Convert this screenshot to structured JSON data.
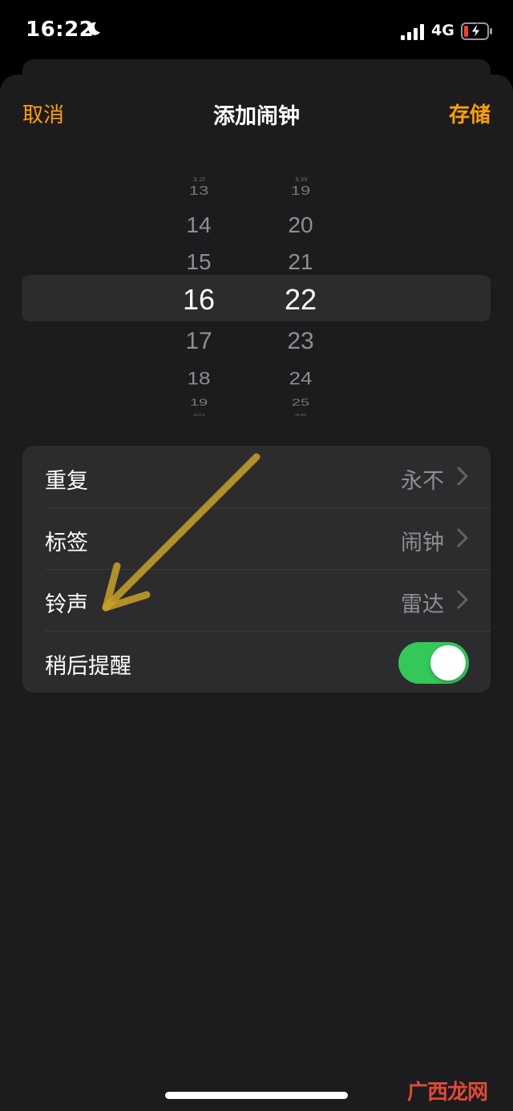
{
  "status_bar": {
    "time": "16:22",
    "network": "4G",
    "icons": [
      "moon-icon",
      "signal-icon",
      "battery-charging-icon"
    ]
  },
  "nav": {
    "cancel": "取消",
    "title": "添加闹钟",
    "save": "存储"
  },
  "picker": {
    "hours": [
      "12",
      "13",
      "14",
      "15",
      "16",
      "17",
      "18",
      "19",
      "20"
    ],
    "minutes": [
      "18",
      "19",
      "20",
      "21",
      "22",
      "23",
      "24",
      "25",
      "26"
    ],
    "selected_hour": "16",
    "selected_minute": "22"
  },
  "settings": {
    "repeat": {
      "label": "重复",
      "value": "永不"
    },
    "label": {
      "label": "标签",
      "value": "闹钟"
    },
    "sound": {
      "label": "铃声",
      "value": "雷达"
    },
    "snooze": {
      "label": "稍后提醒",
      "enabled": true
    }
  },
  "colors": {
    "accent": "#ff9f0a",
    "toggle_on": "#34c759",
    "arrow": "#c9a227",
    "watermark": "#e04a36"
  },
  "watermark": "广西龙网"
}
